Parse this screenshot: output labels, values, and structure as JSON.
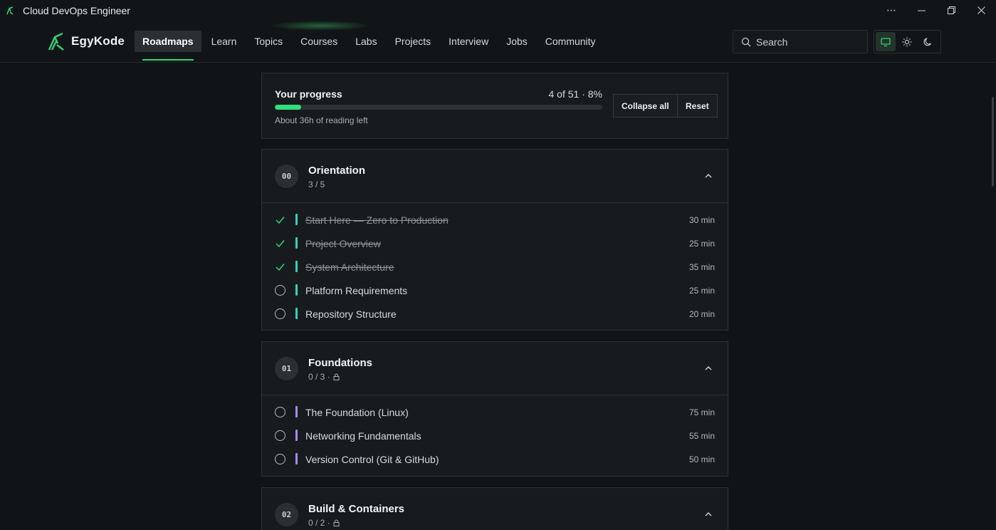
{
  "window": {
    "title": "Cloud DevOps Engineer",
    "controls": [
      "more-icon",
      "minimize-icon",
      "restore-icon",
      "close-icon"
    ]
  },
  "brand": {
    "name": "EgyKode",
    "accent": "#2dd47a"
  },
  "nav": {
    "items": [
      {
        "label": "Roadmaps",
        "active": true
      },
      {
        "label": "Learn"
      },
      {
        "label": "Topics"
      },
      {
        "label": "Courses"
      },
      {
        "label": "Labs"
      },
      {
        "label": "Projects"
      },
      {
        "label": "Interview"
      },
      {
        "label": "Jobs"
      },
      {
        "label": "Community"
      }
    ],
    "search_placeholder": "Search",
    "theme_buttons": [
      "monitor-icon",
      "sun-icon",
      "moon-icon"
    ]
  },
  "progress": {
    "title": "Your progress",
    "stat": "4 of 51 · 8%",
    "fraction": 0.08,
    "subtitle": "About 36h of reading left",
    "collapse_label": "Collapse all",
    "reset_label": "Reset"
  },
  "sections": [
    {
      "badge": "00",
      "title": "Orientation",
      "count": "3 / 5",
      "locked": false,
      "color": "#2dd4bf",
      "items": [
        {
          "label": "Start Here — Zero to Production",
          "mins": "30 min",
          "done": true
        },
        {
          "label": "Project Overview",
          "mins": "25 min",
          "done": true
        },
        {
          "label": "System Architecture",
          "mins": "35 min",
          "done": true
        },
        {
          "label": "Platform Requirements",
          "mins": "25 min",
          "done": false
        },
        {
          "label": "Repository Structure",
          "mins": "20 min",
          "done": false
        }
      ]
    },
    {
      "badge": "01",
      "title": "Foundations",
      "count": "0 / 3 ·",
      "locked": true,
      "color": "#a78bfa",
      "items": [
        {
          "label": "The Foundation (Linux)",
          "mins": "75 min",
          "done": false
        },
        {
          "label": "Networking Fundamentals",
          "mins": "55 min",
          "done": false
        },
        {
          "label": "Version Control (Git & GitHub)",
          "mins": "50 min",
          "done": false
        }
      ]
    },
    {
      "badge": "02",
      "title": "Build & Containers",
      "count": "0 / 2 ·",
      "locked": true,
      "color": "#60a5fa",
      "items": []
    }
  ]
}
